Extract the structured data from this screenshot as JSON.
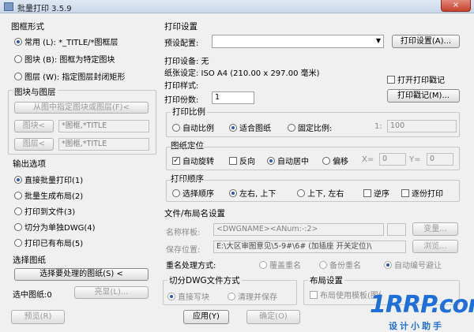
{
  "window": {
    "title": "批量打印 3.5.9",
    "close_glyph": "×"
  },
  "drawing_format": {
    "section": "图框形式",
    "options": [
      {
        "label": "常用 (L): *_TITLE/*图框层",
        "selected": true
      },
      {
        "label": "图块 (B): 图框为特定图块",
        "selected": false
      },
      {
        "label": "图层 (W): 指定图层封闭矩形",
        "selected": false
      }
    ]
  },
  "block_layer": {
    "section": "图块与图层",
    "pick_button": "从图中指定图块或图层(F)<",
    "block_button": "图块<",
    "block_value": "*图框,*TITLE",
    "layer_button": "图层<",
    "layer_value": "*图框,*TITLE"
  },
  "output": {
    "section": "输出选项",
    "options": [
      {
        "label": "直接批量打印(1)",
        "selected": true
      },
      {
        "label": "批量生成布局(2)",
        "selected": false
      },
      {
        "label": "打印到文件(3)",
        "selected": false
      },
      {
        "label": "切分为单独DWG(4)",
        "selected": false
      },
      {
        "label": "打印已有布局(5)",
        "selected": false
      }
    ]
  },
  "select_drawing": {
    "section": "选择图纸",
    "select_button": "选择要处理的图纸(S) <",
    "selected_label": "选中图纸:0",
    "highlight_button": "亮显(L)...",
    "preview_button": "预览(R)"
  },
  "print_settings": {
    "section": "打印设置",
    "preset_label": "预设配置:",
    "preset_value": "",
    "print_settings_button": "打印设置(A)...",
    "device_label": "打印设备: 无",
    "paper_label": "纸张设定: ISO A4 (210.00 x 297.00 毫米)",
    "style_label": "打印样式:",
    "open_stamp_label": "打开打印戳记",
    "open_stamp_checked": false,
    "copies_label": "打印份数:",
    "copies_value": "1",
    "stamp_button": "打印戳记(M)..."
  },
  "scale": {
    "section": "打印比例",
    "options": [
      {
        "label": "自动比例",
        "selected": false
      },
      {
        "label": "适合图纸",
        "selected": true
      },
      {
        "label": "固定比例:",
        "selected": false
      }
    ],
    "ratio_prefix": "1:",
    "ratio_value": "100"
  },
  "position": {
    "section": "图纸定位",
    "auto_rotate_label": "自动旋转",
    "auto_rotate_checked": true,
    "reverse_label": "反向",
    "reverse_checked": false,
    "options": [
      {
        "label": "自动居中",
        "selected": true
      },
      {
        "label": "偏移",
        "selected": false
      }
    ],
    "x_label": "X=",
    "x_value": "0",
    "y_label": "Y=",
    "y_value": "0"
  },
  "order": {
    "section": "打印顺序",
    "options": [
      {
        "label": "选择顺序",
        "selected": false
      },
      {
        "label": "左右, 上下",
        "selected": true
      },
      {
        "label": "上下, 左右",
        "selected": false
      }
    ],
    "reverse_label": "逆序",
    "reverse_checked": false,
    "copy_label": "逐份打印",
    "copy_checked": false
  },
  "file_naming": {
    "section": "文件/布局名设置",
    "name_sample_label": "名称样板:",
    "name_sample_value": "<DWGNAME><ANum:-:2>",
    "variable_button": "变量...",
    "save_path_label": "保存位置:",
    "save_path_value": "E:\\大区审图意见\\5-9#\\6# (加插座 开关定位)\\",
    "browse_button": "浏览..."
  },
  "rename": {
    "label": "重名处理方式:",
    "options": [
      {
        "label": "覆盖重名",
        "selected": false
      },
      {
        "label": "备份重名",
        "selected": false
      },
      {
        "label": "自动编号避让",
        "selected": true
      }
    ]
  },
  "split": {
    "section": "切分DWG文件方式",
    "options": [
      {
        "label": "直接写块",
        "selected": true
      },
      {
        "label": "清理并保存",
        "selected": false
      }
    ]
  },
  "layout": {
    "section": "布局设置",
    "partial_text": "布局使用模板(图纸)设置"
  },
  "footer": {
    "apply_button": "应用(Y)",
    "ok_button": "确定(O)"
  },
  "watermark": {
    "main": "1RRP.com",
    "sub": "设计小助手"
  }
}
